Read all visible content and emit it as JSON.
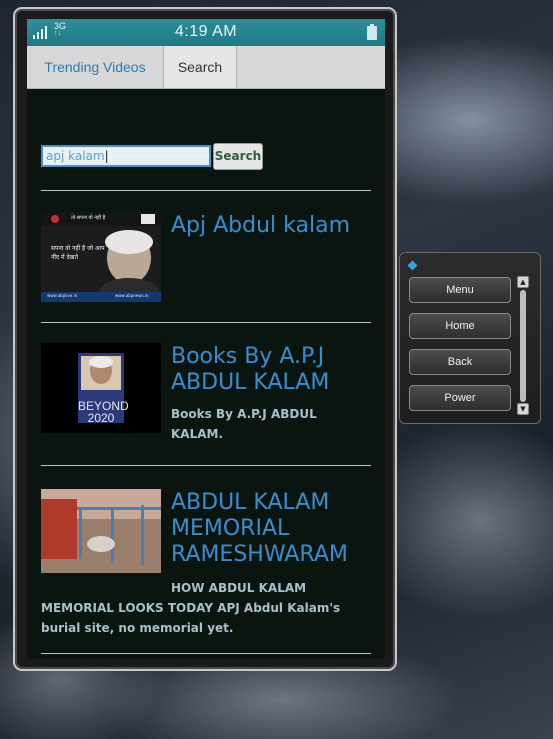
{
  "statusbar": {
    "network": "3G",
    "network_sub": "↑↓",
    "time": "4:19 AM"
  },
  "tabs": [
    {
      "label": "Trending Videos"
    },
    {
      "label": "Search"
    }
  ],
  "search": {
    "value": "apj kalam",
    "button": "Search"
  },
  "results": [
    {
      "title": "Apj Abdul kalam",
      "description": "",
      "thumb_caption_top": "तो सपना वो नहीं है",
      "thumb_caption_mid": "सपना वो नहीं है जो आप नींद में देखते",
      "thumb_footer_left": "www.abplive.in",
      "thumb_footer_right": "www.abpnews.in"
    },
    {
      "title": "Books By A.P.J ABDUL KALAM",
      "description": "Books By A.P.J ABDUL KALAM.",
      "thumb_caption": "BEYOND 2020"
    },
    {
      "title": "ABDUL KALAM MEMORIAL RAMESHWARAM",
      "description": "HOW ABDUL KALAM MEMORIAL LOOKS TODAY APJ Abdul Kalam's burial site, no memorial yet."
    }
  ],
  "panel": {
    "buttons": [
      "Menu",
      "Home",
      "Back",
      "Power"
    ]
  },
  "colors": {
    "statusbar": "#1f7a86",
    "link": "#3a8ed0",
    "screen_bg": "#0b150f"
  }
}
